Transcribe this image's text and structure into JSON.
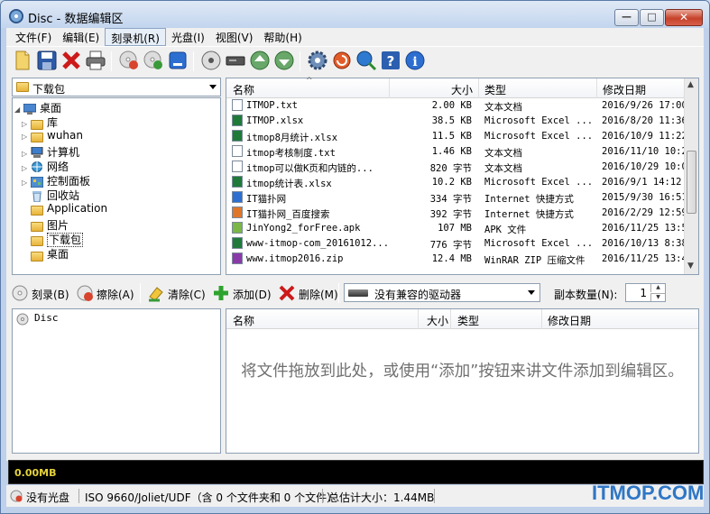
{
  "window": {
    "title": "Disc - 数据编辑区"
  },
  "window_buttons": {
    "minimize": "—",
    "maximize": "□",
    "close": "✕"
  },
  "menu": [
    "文件(F)",
    "编辑(E)",
    "刻录机(R)",
    "光盘(I)",
    "视图(V)",
    "帮助(H)"
  ],
  "folder_combo": {
    "value": "下载包"
  },
  "tree": [
    {
      "label": "桌面",
      "level": 0,
      "icon": "desktop-icon"
    },
    {
      "label": "库",
      "level": 1,
      "icon": "library-icon"
    },
    {
      "label": "wuhan",
      "level": 1,
      "icon": "user-folder-icon"
    },
    {
      "label": "计算机",
      "level": 1,
      "icon": "computer-icon"
    },
    {
      "label": "网络",
      "level": 1,
      "icon": "network-icon"
    },
    {
      "label": "控制面板",
      "level": 1,
      "icon": "control-panel-icon"
    },
    {
      "label": "回收站",
      "level": 1,
      "icon": "recycle-bin-icon"
    },
    {
      "label": "Application",
      "level": 1,
      "icon": "folder-icon"
    },
    {
      "label": "图片",
      "level": 1,
      "icon": "folder-icon"
    },
    {
      "label": "下载包",
      "level": 1,
      "icon": "folder-icon",
      "selected": true
    },
    {
      "label": "桌面",
      "level": 1,
      "icon": "folder-icon"
    }
  ],
  "file_list": {
    "columns": [
      "名称",
      "大小",
      "类型",
      "修改日期"
    ],
    "rows": [
      {
        "name": "ITMOP.txt",
        "size": "2.00 KB",
        "type": "文本文档",
        "date": "2016/9/26 17:00"
      },
      {
        "name": "ITMOP.xlsx",
        "size": "38.5 KB",
        "type": "Microsoft Excel ...",
        "date": "2016/8/20 11:36"
      },
      {
        "name": "itmop8月统计.xlsx",
        "size": "11.5 KB",
        "type": "Microsoft Excel ...",
        "date": "2016/10/9 11:22"
      },
      {
        "name": "itmop考核制度.txt",
        "size": "1.46 KB",
        "type": "文本文档",
        "date": "2016/11/10 10:2"
      },
      {
        "name": "itmop可以做K页和内链的...",
        "size": "820 字节",
        "type": "文本文档",
        "date": "2016/10/29 10:0"
      },
      {
        "name": "itmop统计表.xlsx",
        "size": "10.2 KB",
        "type": "Microsoft Excel ...",
        "date": "2016/9/1 14:12"
      },
      {
        "name": "IT猫扑网",
        "size": "334 字节",
        "type": "Internet 快捷方式",
        "date": "2015/9/30 16:51"
      },
      {
        "name": "IT猫扑网_百度搜索",
        "size": "392 字节",
        "type": "Internet 快捷方式",
        "date": "2016/2/29 12:59"
      },
      {
        "name": "JinYong2_forFree.apk",
        "size": "107 MB",
        "type": "APK 文件",
        "date": "2016/11/25 13:5"
      },
      {
        "name": "www-itmop-com_20161012...",
        "size": "776 字节",
        "type": "Microsoft Excel ...",
        "date": "2016/10/13 8:38"
      },
      {
        "name": "www.itmop2016.zip",
        "size": "12.4 MB",
        "type": "WinRAR ZIP 压缩文件",
        "date": "2016/11/25 13:4"
      }
    ]
  },
  "actions": {
    "burn": "刻录(B)",
    "erase": "擦除(A)",
    "clear": "清除(C)",
    "add": "添加(D)",
    "delete": "删除(M)",
    "drive": "没有兼容的驱动器",
    "copies_label": "副本数量(N):",
    "copies_value": "1"
  },
  "disc_tree": {
    "root": "Disc"
  },
  "disc_list": {
    "columns": [
      "名称",
      "大小",
      "类型",
      "修改日期"
    ],
    "hint": "将文件拖放到此处，或使用“添加”按钮来讲文件添加到编辑区。"
  },
  "progress": {
    "text": "0.00MB"
  },
  "status": {
    "disc": "没有光盘",
    "format": "ISO 9660/Joliet/UDF（含 0 个文件夹和 0 个文件）",
    "total": "总估计大小：1.44MB"
  },
  "watermark": "ITMOP.COM"
}
